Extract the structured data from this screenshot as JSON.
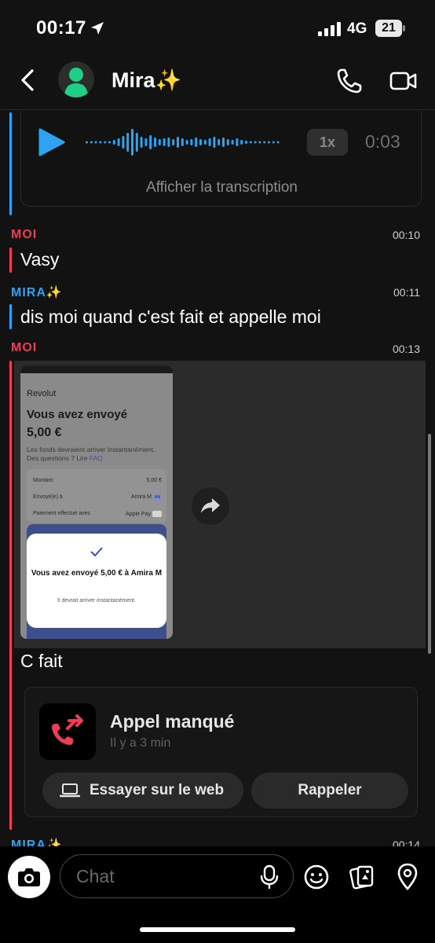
{
  "status_bar": {
    "time": "00:17",
    "network": "4G",
    "battery": "21"
  },
  "header": {
    "contact_name": "Mira✨"
  },
  "voice_note": {
    "speed": "1x",
    "duration": "0:03",
    "transcript_link": "Afficher la transcription"
  },
  "messages": [
    {
      "sender": "MOI",
      "time": "00:10",
      "text": "Vasy"
    },
    {
      "sender": "MIRA✨",
      "time": "00:11",
      "text": "dis moi quand c'est fait et appelle moi"
    },
    {
      "sender": "MOI",
      "time": "00:13",
      "text": "C fait"
    }
  ],
  "screenshot_thumb": {
    "brand": "Revolut",
    "title": "Vous avez envoyé",
    "amount": "5,00 €",
    "note": "Les fonds devraient arriver instantanément. Des questions ? Lire",
    "note_link": "FAQ",
    "rows": [
      {
        "label": "Montant",
        "value": "5,00 €"
      },
      {
        "label": "Envoyé(e) à",
        "value": "Amira M",
        "badge": "AM"
      },
      {
        "label": "Paiement effectué avec",
        "value": "Apple Pay"
      }
    ],
    "sheet_title": "Vous avez envoyé 5,00 € à Amira M",
    "sheet_subtitle": "Il devrait arriver instantanément."
  },
  "missed_call": {
    "title": "Appel manqué",
    "subtitle": "Il y a 3 min",
    "try_web_label": "Essayer sur le web",
    "call_back_label": "Rappeler"
  },
  "next_message": {
    "sender": "MIRA✨",
    "time": "00:14"
  },
  "composer": {
    "placeholder": "Chat"
  },
  "colors": {
    "me": "#f23c57",
    "mira": "#2ea3f2",
    "background": "#121212"
  },
  "icons": [
    "location-arrow-icon",
    "signal-icon",
    "battery-icon",
    "back-chevron-icon",
    "avatar-icon",
    "phone-icon",
    "video-camera-icon",
    "play-icon",
    "waveform-icon",
    "share-arrow-icon",
    "missed-call-icon",
    "laptop-icon",
    "camera-icon",
    "microphone-icon",
    "emoji-icon",
    "sticker-icon",
    "location-pin-icon"
  ]
}
